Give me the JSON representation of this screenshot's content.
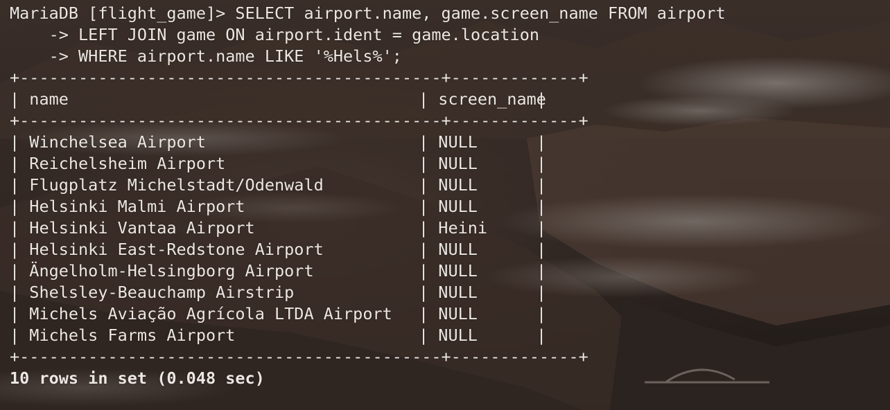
{
  "terminal": {
    "prompt": "MariaDB [flight_game]> ",
    "query_lines": [
      "SELECT airport.name, game.screen_name FROM airport",
      "    -> LEFT JOIN game ON airport.ident = game.location",
      "    -> WHERE airport.name LIKE '%Hels%';"
    ]
  },
  "table": {
    "border": "+-------------------------------------------+-------------+",
    "columns": [
      "name",
      "screen_name"
    ],
    "rows": [
      [
        "Winchelsea Airport",
        "NULL"
      ],
      [
        "Reichelsheim Airport",
        "NULL"
      ],
      [
        "Flugplatz Michelstadt/Odenwald",
        "NULL"
      ],
      [
        "Helsinki Malmi Airport",
        "NULL"
      ],
      [
        "Helsinki Vantaa Airport",
        "Heini"
      ],
      [
        "Helsinki East-Redstone Airport",
        "NULL"
      ],
      [
        "Ängelholm-Helsingborg Airport",
        "NULL"
      ],
      [
        "Shelsley-Beauchamp Airstrip",
        "NULL"
      ],
      [
        "Michels Aviação Agrícola LTDA Airport",
        "NULL"
      ],
      [
        "Michels Farms Airport",
        "NULL"
      ]
    ]
  },
  "result_summary": "10 rows in set (0.048 sec)"
}
